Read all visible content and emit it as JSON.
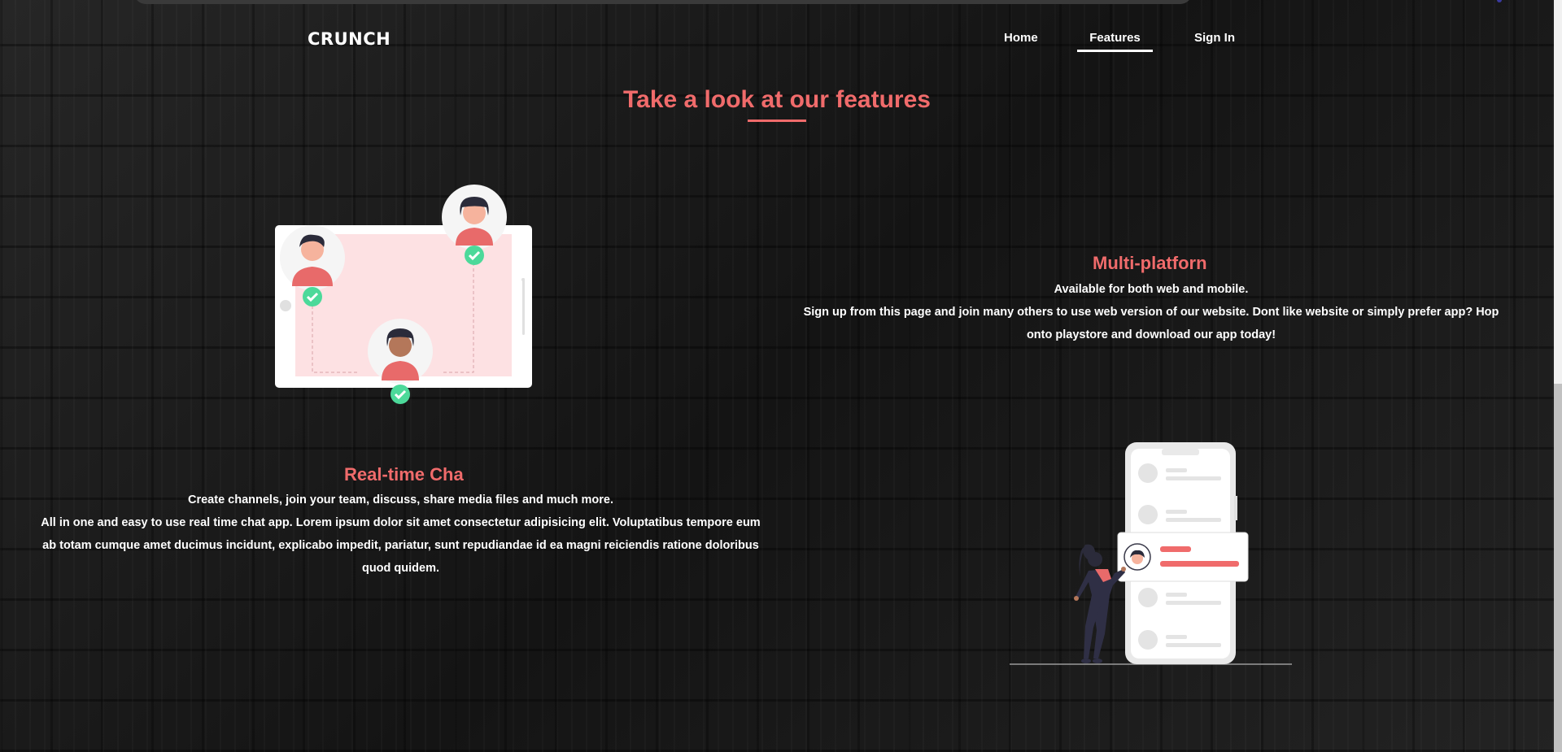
{
  "brand": "CRUNCH",
  "nav": {
    "home": "Home",
    "features": "Features",
    "sign_in": "Sign In",
    "active": "features"
  },
  "section": {
    "title": "Take a look at our features"
  },
  "features": [
    {
      "heading": "Multi-platforn",
      "line1": "Available for both web and mobile.",
      "line2": "Sign up from this page and join many others to use web version of our website. Dont like website or simply prefer app? Hop onto playstore and download our app today!"
    },
    {
      "heading": "Real-time Cha",
      "line1": "Create channels, join your team, discuss, share media files and much more.",
      "line2": "All in one and easy to use real time chat app. Lorem ipsum dolor sit amet consectetur adipisicing elit. Voluptatibus tempore eum ab totam cumque amet ducimus incidunt, explicabo impedit, pariatur, sunt repudiandae id ea magni reiciendis ratione doloribus quod quidem."
    }
  ],
  "colors": {
    "accent": "#f06b6b",
    "check": "#4cd99a",
    "tablet_screen": "#fde1e3"
  },
  "icons": {
    "check": "check-circle-icon",
    "avatar": "user-avatar-icon"
  }
}
